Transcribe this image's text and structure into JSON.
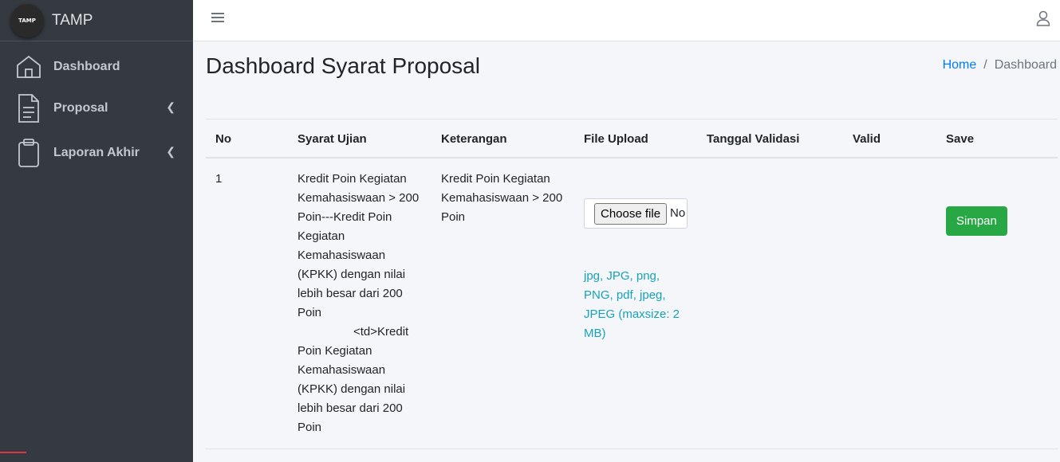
{
  "brand": {
    "logo_text": "TAMP",
    "name": "TAMP"
  },
  "sidebar": {
    "items": [
      {
        "label": "Dashboard"
      },
      {
        "label": "Proposal"
      },
      {
        "label": "Laporan Akhir"
      }
    ]
  },
  "page": {
    "title": "Dashboard Syarat Proposal"
  },
  "breadcrumb": {
    "home": "Home",
    "separator": "/",
    "current": "Dashboard"
  },
  "table": {
    "headers": [
      "No",
      "Syarat Ujian",
      "Keterangan",
      "File Upload",
      "Tanggal Validasi",
      "Valid",
      "Save"
    ],
    "rows": [
      {
        "no": "1",
        "syarat": "Kredit Poin Kegiatan Kemahasiswaan > 200 Poin---Kredit Poin Kegiatan Kemahasiswaan (KPKK) dengan nilai lebih besar dari 200 Poin",
        "syarat_extra": "<td>Kredit Poin Kegiatan Kemahasiswaan (KPKK) dengan nilai lebih besar dari 200 Poin",
        "keterangan": "Kredit Poin Kegiatan Kemahasiswaan > 200 Poin",
        "file_button": "Choose file",
        "file_status": "No",
        "file_help": "jpg, JPG, png, PNG, pdf, jpeg, JPEG (maxsize: 2 MB)",
        "tanggal": "",
        "valid": "",
        "save_label": "Simpan"
      }
    ]
  }
}
